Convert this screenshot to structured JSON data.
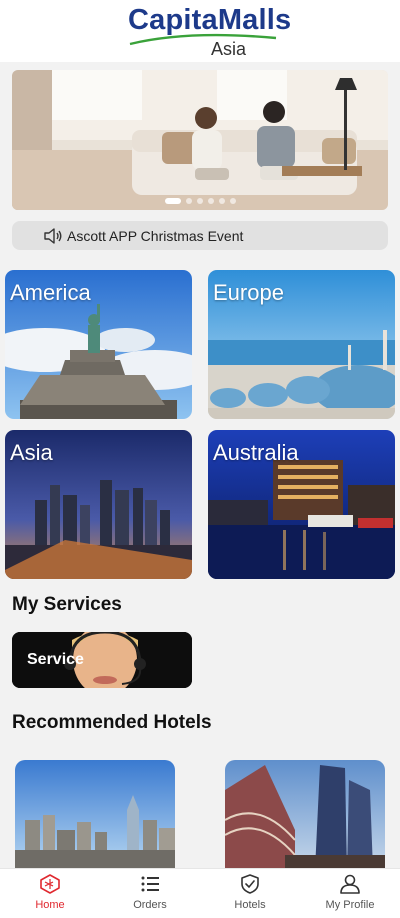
{
  "header": {
    "logo_main": "CapitaMalls",
    "logo_sub": "Asia"
  },
  "banner": {
    "slide_count": 6,
    "active_index": 0
  },
  "notice": {
    "icon": "speaker-icon",
    "text": "Ascott APP Christmas Event"
  },
  "regions": [
    {
      "label": "America"
    },
    {
      "label": "Europe"
    },
    {
      "label": "Asia"
    },
    {
      "label": "Australia"
    }
  ],
  "services": {
    "title": "My Services",
    "items": [
      {
        "label": "Service"
      }
    ]
  },
  "hotels": {
    "title": "Recommended Hotels"
  },
  "tabbar": {
    "items": [
      {
        "label": "Home",
        "icon": "home-cube-icon",
        "active": true
      },
      {
        "label": "Orders",
        "icon": "list-icon",
        "active": false
      },
      {
        "label": "Hotels",
        "icon": "shield-check-icon",
        "active": false
      },
      {
        "label": "My Profile",
        "icon": "user-icon",
        "active": false
      }
    ]
  },
  "colors": {
    "accent": "#e0282f",
    "brand_blue": "#1d3a8a",
    "brand_green": "#3aa23a"
  }
}
